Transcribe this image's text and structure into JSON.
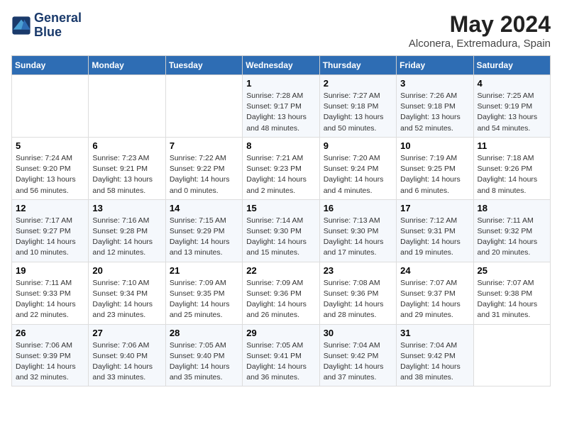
{
  "header": {
    "logo_line1": "General",
    "logo_line2": "Blue",
    "title": "May 2024",
    "subtitle": "Alconera, Extremadura, Spain"
  },
  "days_of_week": [
    "Sunday",
    "Monday",
    "Tuesday",
    "Wednesday",
    "Thursday",
    "Friday",
    "Saturday"
  ],
  "weeks": [
    [
      {
        "day": "",
        "info": ""
      },
      {
        "day": "",
        "info": ""
      },
      {
        "day": "",
        "info": ""
      },
      {
        "day": "1",
        "info": "Sunrise: 7:28 AM\nSunset: 9:17 PM\nDaylight: 13 hours\nand 48 minutes."
      },
      {
        "day": "2",
        "info": "Sunrise: 7:27 AM\nSunset: 9:18 PM\nDaylight: 13 hours\nand 50 minutes."
      },
      {
        "day": "3",
        "info": "Sunrise: 7:26 AM\nSunset: 9:18 PM\nDaylight: 13 hours\nand 52 minutes."
      },
      {
        "day": "4",
        "info": "Sunrise: 7:25 AM\nSunset: 9:19 PM\nDaylight: 13 hours\nand 54 minutes."
      }
    ],
    [
      {
        "day": "5",
        "info": "Sunrise: 7:24 AM\nSunset: 9:20 PM\nDaylight: 13 hours\nand 56 minutes."
      },
      {
        "day": "6",
        "info": "Sunrise: 7:23 AM\nSunset: 9:21 PM\nDaylight: 13 hours\nand 58 minutes."
      },
      {
        "day": "7",
        "info": "Sunrise: 7:22 AM\nSunset: 9:22 PM\nDaylight: 14 hours\nand 0 minutes."
      },
      {
        "day": "8",
        "info": "Sunrise: 7:21 AM\nSunset: 9:23 PM\nDaylight: 14 hours\nand 2 minutes."
      },
      {
        "day": "9",
        "info": "Sunrise: 7:20 AM\nSunset: 9:24 PM\nDaylight: 14 hours\nand 4 minutes."
      },
      {
        "day": "10",
        "info": "Sunrise: 7:19 AM\nSunset: 9:25 PM\nDaylight: 14 hours\nand 6 minutes."
      },
      {
        "day": "11",
        "info": "Sunrise: 7:18 AM\nSunset: 9:26 PM\nDaylight: 14 hours\nand 8 minutes."
      }
    ],
    [
      {
        "day": "12",
        "info": "Sunrise: 7:17 AM\nSunset: 9:27 PM\nDaylight: 14 hours\nand 10 minutes."
      },
      {
        "day": "13",
        "info": "Sunrise: 7:16 AM\nSunset: 9:28 PM\nDaylight: 14 hours\nand 12 minutes."
      },
      {
        "day": "14",
        "info": "Sunrise: 7:15 AM\nSunset: 9:29 PM\nDaylight: 14 hours\nand 13 minutes."
      },
      {
        "day": "15",
        "info": "Sunrise: 7:14 AM\nSunset: 9:30 PM\nDaylight: 14 hours\nand 15 minutes."
      },
      {
        "day": "16",
        "info": "Sunrise: 7:13 AM\nSunset: 9:30 PM\nDaylight: 14 hours\nand 17 minutes."
      },
      {
        "day": "17",
        "info": "Sunrise: 7:12 AM\nSunset: 9:31 PM\nDaylight: 14 hours\nand 19 minutes."
      },
      {
        "day": "18",
        "info": "Sunrise: 7:11 AM\nSunset: 9:32 PM\nDaylight: 14 hours\nand 20 minutes."
      }
    ],
    [
      {
        "day": "19",
        "info": "Sunrise: 7:11 AM\nSunset: 9:33 PM\nDaylight: 14 hours\nand 22 minutes."
      },
      {
        "day": "20",
        "info": "Sunrise: 7:10 AM\nSunset: 9:34 PM\nDaylight: 14 hours\nand 23 minutes."
      },
      {
        "day": "21",
        "info": "Sunrise: 7:09 AM\nSunset: 9:35 PM\nDaylight: 14 hours\nand 25 minutes."
      },
      {
        "day": "22",
        "info": "Sunrise: 7:09 AM\nSunset: 9:36 PM\nDaylight: 14 hours\nand 26 minutes."
      },
      {
        "day": "23",
        "info": "Sunrise: 7:08 AM\nSunset: 9:36 PM\nDaylight: 14 hours\nand 28 minutes."
      },
      {
        "day": "24",
        "info": "Sunrise: 7:07 AM\nSunset: 9:37 PM\nDaylight: 14 hours\nand 29 minutes."
      },
      {
        "day": "25",
        "info": "Sunrise: 7:07 AM\nSunset: 9:38 PM\nDaylight: 14 hours\nand 31 minutes."
      }
    ],
    [
      {
        "day": "26",
        "info": "Sunrise: 7:06 AM\nSunset: 9:39 PM\nDaylight: 14 hours\nand 32 minutes."
      },
      {
        "day": "27",
        "info": "Sunrise: 7:06 AM\nSunset: 9:40 PM\nDaylight: 14 hours\nand 33 minutes."
      },
      {
        "day": "28",
        "info": "Sunrise: 7:05 AM\nSunset: 9:40 PM\nDaylight: 14 hours\nand 35 minutes."
      },
      {
        "day": "29",
        "info": "Sunrise: 7:05 AM\nSunset: 9:41 PM\nDaylight: 14 hours\nand 36 minutes."
      },
      {
        "day": "30",
        "info": "Sunrise: 7:04 AM\nSunset: 9:42 PM\nDaylight: 14 hours\nand 37 minutes."
      },
      {
        "day": "31",
        "info": "Sunrise: 7:04 AM\nSunset: 9:42 PM\nDaylight: 14 hours\nand 38 minutes."
      },
      {
        "day": "",
        "info": ""
      }
    ]
  ]
}
